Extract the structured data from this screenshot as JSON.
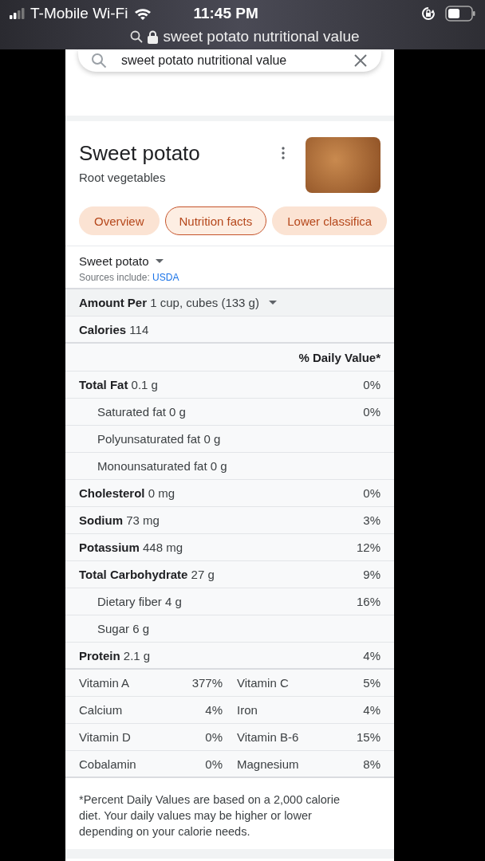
{
  "status_bar": {
    "carrier": "T-Mobile Wi-Fi",
    "time": "11:45 PM",
    "url": "sweet potato nutritional value"
  },
  "search": {
    "value": "sweet potato nutritional value"
  },
  "header": {
    "title": "Sweet potato",
    "subtitle": "Root vegetables"
  },
  "chips": [
    {
      "label": "Overview",
      "selected": false
    },
    {
      "label": "Nutrition facts",
      "selected": true
    },
    {
      "label": "Lower classifica",
      "selected": false
    }
  ],
  "selector": {
    "value": "Sweet potato",
    "sources_label": "Sources include:",
    "source_link": "USDA"
  },
  "amount": {
    "label": "Amount Per",
    "value": "1 cup, cubes (133 g)"
  },
  "calories": {
    "label": "Calories",
    "value": "114"
  },
  "daily_value_header": "% Daily Value*",
  "nutrients": [
    {
      "kind": "main",
      "name": "Total Fat",
      "amount": "0.1 g",
      "dv": "0%"
    },
    {
      "kind": "sub",
      "name": "Saturated fat",
      "amount": "0 g",
      "dv": "0%"
    },
    {
      "kind": "sub",
      "name": "Polyunsaturated fat",
      "amount": "0 g"
    },
    {
      "kind": "sub",
      "name": "Monounsaturated fat",
      "amount": "0 g"
    },
    {
      "kind": "main",
      "name": "Cholesterol",
      "amount": "0 mg",
      "dv": "0%"
    },
    {
      "kind": "main",
      "name": "Sodium",
      "amount": "73 mg",
      "dv": "3%"
    },
    {
      "kind": "main",
      "name": "Potassium",
      "amount": "448 mg",
      "dv": "12%"
    },
    {
      "kind": "main",
      "name": "Total Carbohydrate",
      "amount": "27 g",
      "dv": "9%"
    },
    {
      "kind": "sub",
      "name": "Dietary fiber",
      "amount": "4 g",
      "dv": "16%"
    },
    {
      "kind": "sub",
      "name": "Sugar",
      "amount": "6 g"
    },
    {
      "kind": "main",
      "name": "Protein",
      "amount": "2.1 g",
      "dv": "4%"
    }
  ],
  "vitamins": [
    [
      {
        "name": "Vitamin A",
        "dv": "377%"
      },
      {
        "name": "Vitamin C",
        "dv": "5%"
      }
    ],
    [
      {
        "name": "Calcium",
        "dv": "4%"
      },
      {
        "name": "Iron",
        "dv": "4%"
      }
    ],
    [
      {
        "name": "Vitamin D",
        "dv": "0%"
      },
      {
        "name": "Vitamin B-6",
        "dv": "15%"
      }
    ],
    [
      {
        "name": "Cobalamin",
        "dv": "0%"
      },
      {
        "name": "Magnesium",
        "dv": "8%"
      }
    ]
  ],
  "footnote": "*Percent Daily Values are based on a 2,000 calorie diet. Your daily values may be higher or lower depending on your calorie needs."
}
